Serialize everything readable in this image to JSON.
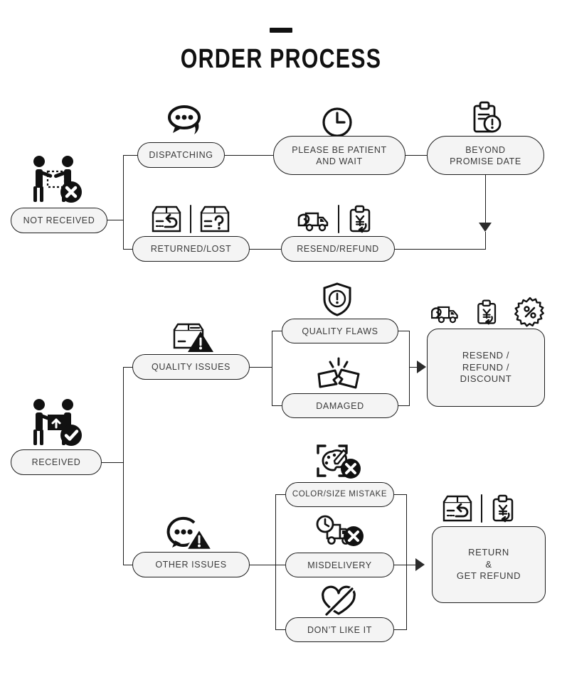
{
  "header": {
    "title": "ORDER PROCESS",
    "accent_dash_color": "#111111"
  },
  "theme": {
    "node_fill": "#f4f4f4",
    "node_border": "#1d1d1d",
    "text_color": "#3a3a3a",
    "line_color": "#1b1b1b",
    "icon_color": "#111111",
    "background": "#ffffff"
  },
  "chart_data": {
    "type": "diagram",
    "title": "ORDER PROCESS",
    "subtitle": "",
    "layout": "left-to-right flowchart, two root branches",
    "roots": [
      "NOT RECEIVED",
      "RECEIVED"
    ],
    "nodes": [
      {
        "id": "not_received",
        "label": "NOT RECEIVED",
        "icon": "handoff-cross-icon"
      },
      {
        "id": "dispatching",
        "label": "DISPATCHING",
        "icon": "chat-bubble-icon"
      },
      {
        "id": "patient",
        "label": "PLEASE BE PATIENT AND WAIT",
        "icon": "clock-icon"
      },
      {
        "id": "beyond",
        "label": "BEYOND PROMISE DATE",
        "icon": "clipboard-alert-icon"
      },
      {
        "id": "returned_lost",
        "label": "RETURNED/LOST",
        "icon": "box-return-box-question-icon"
      },
      {
        "id": "resend_refund",
        "label": "RESEND/REFUND",
        "icon": "truck-return-yen-refund-icon"
      },
      {
        "id": "received",
        "label": "RECEIVED",
        "icon": "handoff-check-icon"
      },
      {
        "id": "quality_issues",
        "label": "QUALITY ISSUES",
        "icon": "box-warning-icon"
      },
      {
        "id": "quality_flaws",
        "label": "QUALITY FLAWS",
        "icon": "shield-alert-icon"
      },
      {
        "id": "damaged",
        "label": "DAMAGED",
        "icon": "broken-item-icon"
      },
      {
        "id": "resend_refund_discount",
        "label": "RESEND / REFUND / DISCOUNT",
        "icon": "truck-yen-percent-icon"
      },
      {
        "id": "other_issues",
        "label": "OTHER ISSUES",
        "icon": "chat-warning-icon"
      },
      {
        "id": "color_size",
        "label": "COLOR/SIZE MISTAKE",
        "icon": "palette-cross-icon"
      },
      {
        "id": "misdelivery",
        "label": "MISDELIVERY",
        "icon": "truck-clock-cross-icon"
      },
      {
        "id": "dont_like",
        "label": "DON’T LIKE IT",
        "icon": "heart-slash-icon"
      },
      {
        "id": "return_get_refund",
        "label": "RETURN & GET REFUND",
        "icon": "box-return-yen-refund-icon"
      }
    ],
    "edges": [
      {
        "from": "not_received",
        "to": "dispatching"
      },
      {
        "from": "not_received",
        "to": "returned_lost"
      },
      {
        "from": "dispatching",
        "to": "patient"
      },
      {
        "from": "patient",
        "to": "beyond"
      },
      {
        "from": "beyond",
        "to": "resend_refund",
        "arrow": true
      },
      {
        "from": "returned_lost",
        "to": "resend_refund"
      },
      {
        "from": "received",
        "to": "quality_issues"
      },
      {
        "from": "received",
        "to": "other_issues"
      },
      {
        "from": "quality_issues",
        "to": "quality_flaws"
      },
      {
        "from": "quality_issues",
        "to": "damaged"
      },
      {
        "from": "quality_flaws",
        "to": "resend_refund_discount",
        "arrow": true
      },
      {
        "from": "damaged",
        "to": "resend_refund_discount",
        "arrow": true
      },
      {
        "from": "other_issues",
        "to": "color_size"
      },
      {
        "from": "other_issues",
        "to": "misdelivery"
      },
      {
        "from": "other_issues",
        "to": "dont_like"
      },
      {
        "from": "color_size",
        "to": "return_get_refund",
        "arrow": true
      },
      {
        "from": "misdelivery",
        "to": "return_get_refund",
        "arrow": true
      },
      {
        "from": "dont_like",
        "to": "return_get_refund",
        "arrow": true
      }
    ]
  },
  "flow_not_received": {
    "root_label": "NOT RECEIVED",
    "dispatching_label": "DISPATCHING",
    "patient_line1": "PLEASE BE PATIENT",
    "patient_line2": "AND WAIT",
    "beyond_line1": "BEYOND",
    "beyond_line2": "PROMISE DATE",
    "returned_lost_label": "RETURNED/LOST",
    "resend_refund_label": "RESEND/REFUND"
  },
  "flow_received": {
    "root_label": "RECEIVED",
    "quality_issues_label": "QUALITY ISSUES",
    "quality_flaws_label": "QUALITY FLAWS",
    "damaged_label": "DAMAGED",
    "outcome1_line1": "RESEND /",
    "outcome1_line2": "REFUND /",
    "outcome1_line3": "DISCOUNT",
    "other_issues_label": "OTHER ISSUES",
    "color_size_label": "COLOR/SIZE MISTAKE",
    "misdelivery_label": "MISDELIVERY",
    "dont_like_label": "DON’T LIKE IT",
    "outcome2_line1": "RETURN",
    "outcome2_line2": "&",
    "outcome2_line3": "GET REFUND"
  },
  "icons": {
    "handoff_cross": "handoff-cross-icon",
    "chat_bubble": "chat-bubble-icon",
    "clock": "clock-icon",
    "clipboard_alert": "clipboard-alert-icon",
    "box_return": "box-return-icon",
    "box_question": "box-question-icon",
    "truck_return": "truck-return-icon",
    "yen_refund": "yen-refund-icon",
    "handoff_check": "handoff-check-icon",
    "box_warning": "box-warning-icon",
    "shield_alert": "shield-alert-icon",
    "broken_item": "broken-item-icon",
    "percent_badge": "percent-badge-icon",
    "chat_warning": "chat-warning-icon",
    "palette_cross": "palette-cross-icon",
    "truck_clock_cross": "truck-clock-cross-icon",
    "heart_slash": "heart-slash-icon"
  }
}
